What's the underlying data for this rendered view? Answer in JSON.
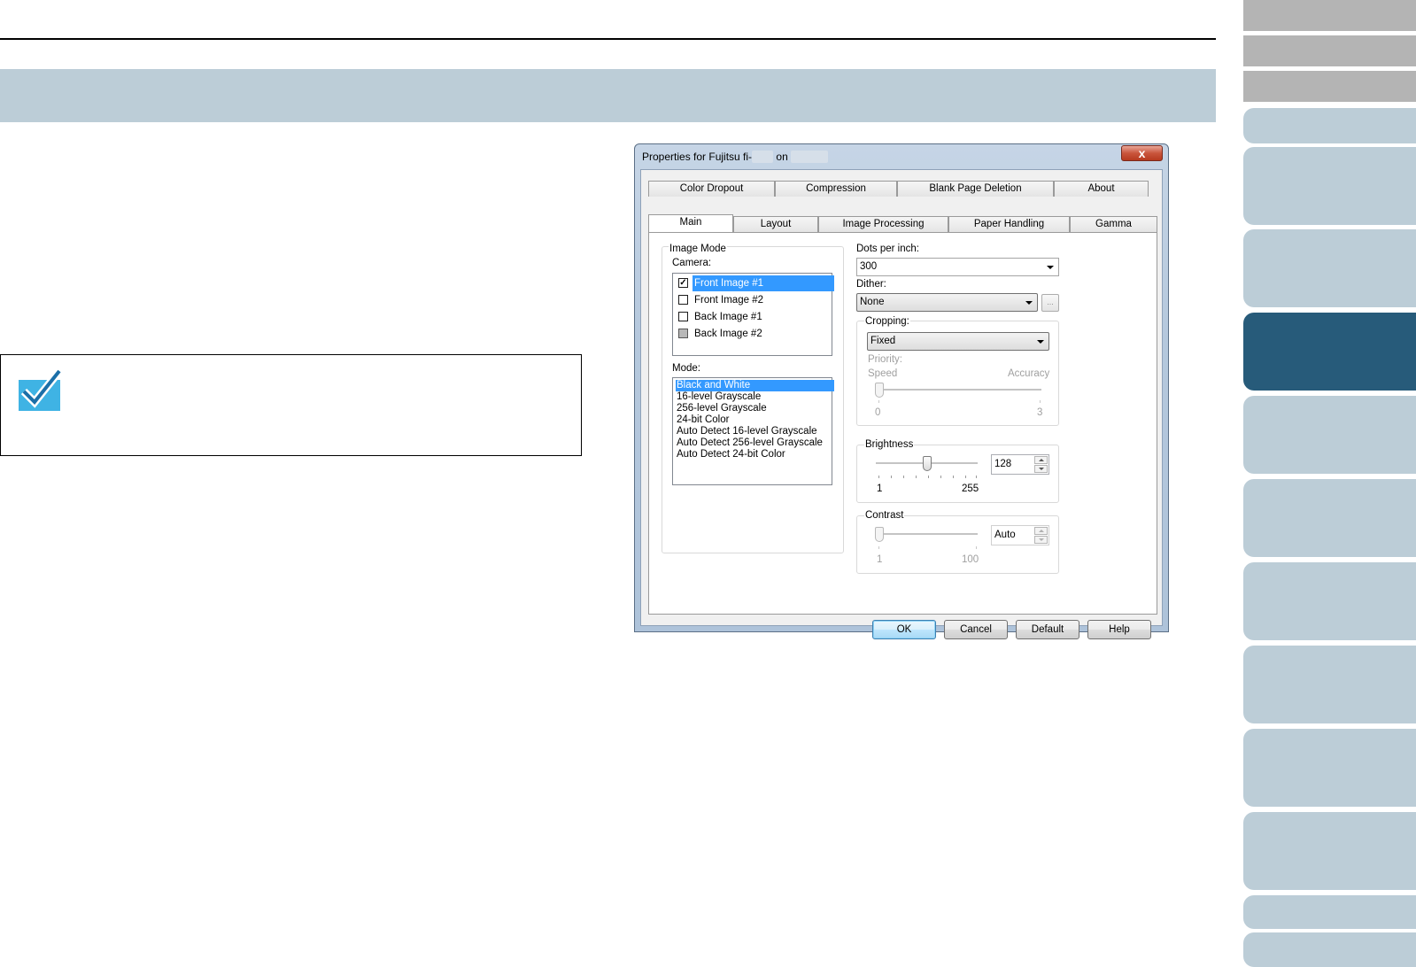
{
  "nav_tabs": {
    "count_gray": 3,
    "count_blue": 10,
    "active_index": 2
  },
  "dialog": {
    "title_prefix": "Properties for Fujitsu fi-",
    "title_on": "on",
    "close_label": "x",
    "tabs_row1": [
      "Color Dropout",
      "Compression",
      "Blank Page Deletion",
      "About"
    ],
    "tabs_row2": [
      "Main",
      "Layout",
      "Image Processing",
      "Paper Handling",
      "Gamma"
    ],
    "active_tab": "Main",
    "image_mode": {
      "group_label": "Image Mode",
      "camera_label": "Camera:",
      "camera_items": [
        {
          "label": "Front Image #1",
          "checked": true,
          "selected": true
        },
        {
          "label": "Front Image #2",
          "checked": false,
          "selected": false
        },
        {
          "label": "Back Image #1",
          "checked": false,
          "selected": false
        },
        {
          "label": "Back Image #2",
          "checked": false,
          "selected": false
        }
      ],
      "mode_label": "Mode:",
      "mode_items": [
        "Black and White",
        "16-level Grayscale",
        "256-level Grayscale",
        "24-bit Color",
        "Auto Detect 16-level Grayscale",
        "Auto Detect 256-level Grayscale",
        "Auto Detect 24-bit Color"
      ],
      "mode_selected": "Black and White"
    },
    "dpi": {
      "label": "Dots per inch:",
      "value": "300"
    },
    "dither": {
      "label": "Dither:",
      "value": "None",
      "more_label": "..."
    },
    "cropping": {
      "label": "Cropping:",
      "value": "Fixed",
      "priority_label": "Priority:",
      "speed_label": "Speed",
      "accuracy_label": "Accuracy",
      "min_label": "0",
      "max_label": "3",
      "level": 0
    },
    "brightness": {
      "label": "Brightness",
      "value": "128",
      "min_label": "1",
      "max_label": "255",
      "level": 0.5
    },
    "contrast": {
      "label": "Contrast",
      "value": "Auto",
      "min_label": "1",
      "max_label": "100",
      "level": 0
    },
    "buttons": {
      "ok": "OK",
      "cancel": "Cancel",
      "default": "Default",
      "help": "Help"
    }
  },
  "colors": {
    "banner": "#bccdd7",
    "nav_active": "#275b7a",
    "nav_gray": "#b4b4b4",
    "selection": "#3399ff",
    "check_icon": "#3fb3e4"
  }
}
